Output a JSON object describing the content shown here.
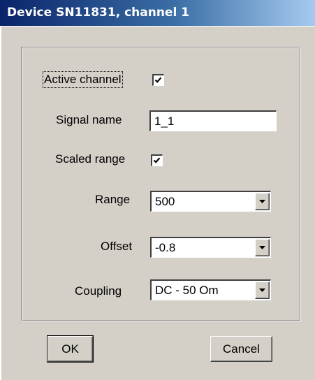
{
  "window": {
    "title": "Device SN11831, channel 1"
  },
  "form": {
    "active_channel_label": "Active channel",
    "active_channel_checked": true,
    "signal_name_label": "Signal name",
    "signal_name_value": "1_1",
    "scaled_range_label": "Scaled range",
    "scaled_range_checked": true,
    "range_label": "Range",
    "range_value": "500",
    "offset_label": "Offset",
    "offset_value": "-0.8",
    "coupling_label": "Coupling",
    "coupling_value": "DC - 50 Om"
  },
  "buttons": {
    "ok_label": "OK",
    "cancel_label": "Cancel"
  },
  "icons": {
    "checkbox_mark": "checkmark-icon",
    "dropdown_arrow": "chevron-down-icon"
  },
  "colors": {
    "titlebar_start": "#0a246a",
    "titlebar_end": "#a6caf0",
    "face": "#d4d0c8"
  }
}
